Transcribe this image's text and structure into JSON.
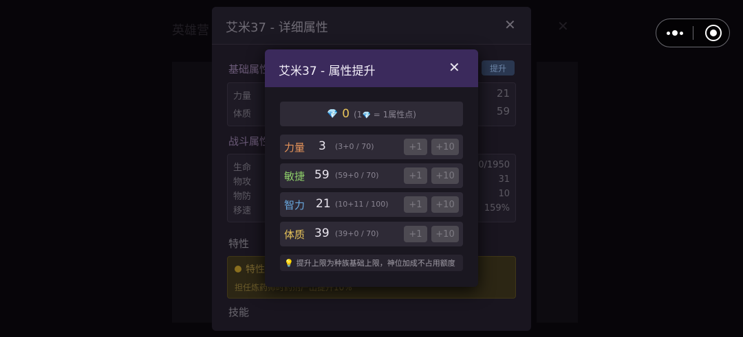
{
  "background": {
    "title": "英雄营",
    "close_icon": "close-icon"
  },
  "capsule": {
    "more_icon": "more-dots-icon",
    "close_icon": "target-close-icon"
  },
  "detail_panel": {
    "title": "艾米37 - 详细属性",
    "basic_section": "基础属性",
    "boost_button": "提升",
    "basic_rows": [
      {
        "label": "力量",
        "value": "21"
      },
      {
        "label": "体质",
        "value": "59"
      }
    ],
    "battle_section": "战斗属性",
    "battle_rows": [
      {
        "label": "生命",
        "value": "1950/1950"
      },
      {
        "label": "物攻",
        "value": "31"
      },
      {
        "label": "物防",
        "value": "10"
      },
      {
        "label": "移速",
        "value": "159%"
      }
    ],
    "trait_section": "特性",
    "trait_name": "特性",
    "trait_desc": "担任炼药师时药剂产出提升10%",
    "skill_section": "技能"
  },
  "modal": {
    "title": "艾米37 - 属性提升",
    "gems": {
      "count": "0",
      "rate_prefix": "(1",
      "rate_suffix": " = 1属性点)"
    },
    "attributes": [
      {
        "name": "力量",
        "value": "3",
        "detail": "(3+0 / 70)",
        "color": "#e8955a"
      },
      {
        "name": "敏捷",
        "value": "59",
        "detail": "(59+0 / 70)",
        "color": "#8fd06a"
      },
      {
        "name": "智力",
        "value": "21",
        "detail": "(10+11 / 100)",
        "color": "#6aa9e0"
      },
      {
        "name": "体质",
        "value": "39",
        "detail": "(39+0 / 70)",
        "color": "#e8c45a"
      }
    ],
    "buttons": {
      "plus_one": "+1",
      "plus_ten": "+10"
    },
    "tip": "提升上限为种族基础上限，神位加成不占用额度"
  },
  "colors": {
    "accent": "#3b2a5c",
    "gem": "#6aa9e0",
    "gold": "#e8c45a"
  }
}
